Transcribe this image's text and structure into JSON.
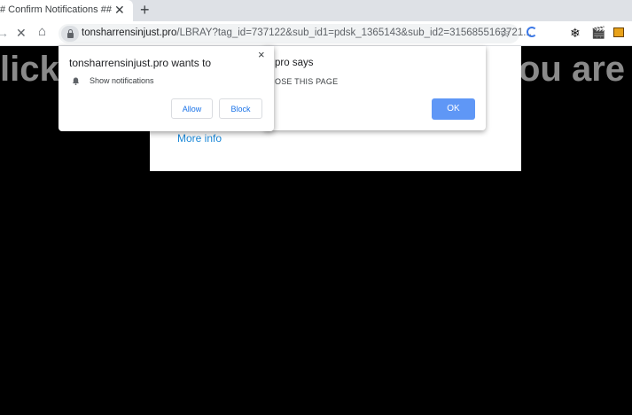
{
  "tab": {
    "title": "# Confirm Notifications ##",
    "close": "✕",
    "new_tab": "+"
  },
  "toolbar": {
    "back_icon": "→",
    "reload_icon": "✕",
    "home_icon": "⌂",
    "url_host": "tonsharrensinjust.pro",
    "url_path": "/LBRAY?tag_id=737122&sub_id1=pdsk_1365143&sub_id2=3156855163721...",
    "star_icon": "☆",
    "ext2_icon": "❄",
    "ext3_icon": "🎬"
  },
  "page": {
    "big_left": "lick",
    "big_right": "ou are"
  },
  "alert": {
    "title": "pro says",
    "message": "OSE THIS PAGE",
    "ok_label": "OK",
    "more_info": "More info"
  },
  "notification": {
    "title": "tonsharrensinjust.pro wants to",
    "close": "×",
    "permission_label": "Show notifications",
    "allow_label": "Allow",
    "block_label": "Block"
  }
}
